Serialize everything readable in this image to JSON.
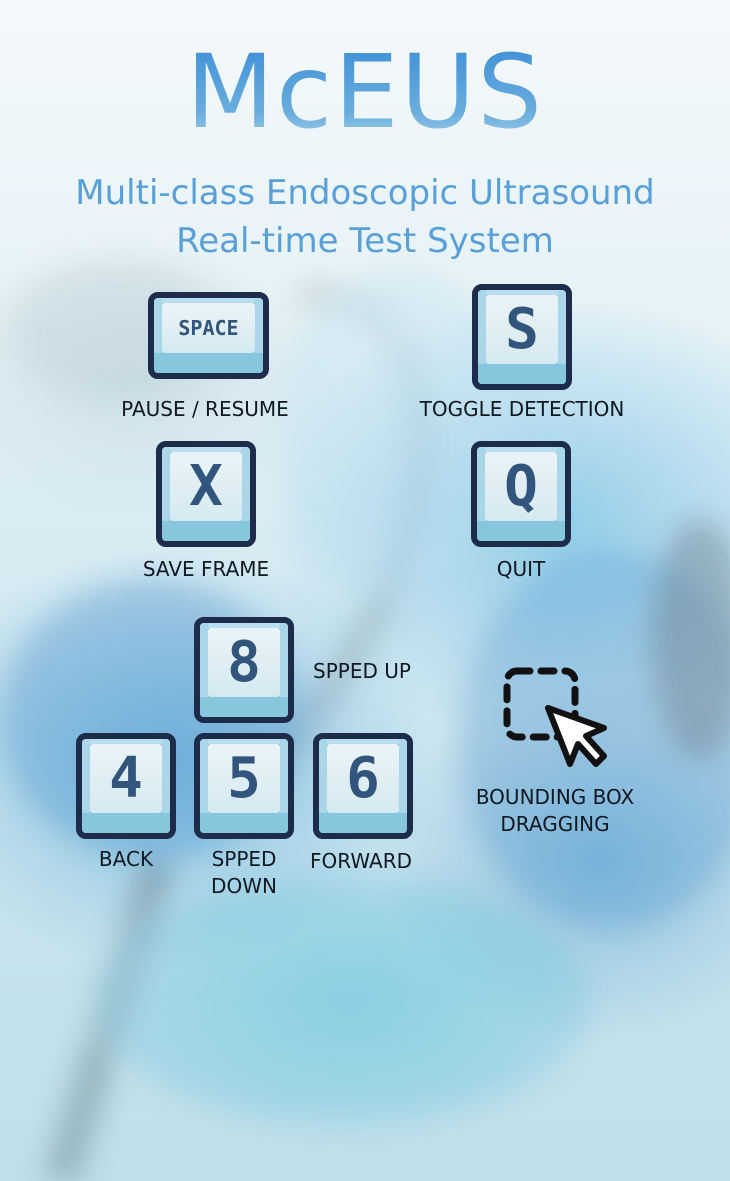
{
  "app": {
    "title": "McEUS",
    "subtitle_line1": "Multi-class Endoscopic Ultrasound",
    "subtitle_line2": "Real-time Test System"
  },
  "colors": {
    "title": "#5a9fd4",
    "subtitle": "#5aa0d8",
    "key_border": "#1c2c4a",
    "key_glyph": "#31557d",
    "key_base": "#7ec3dc",
    "label": "#101820"
  },
  "controls": [
    {
      "key": "SPACE",
      "label": "PAUSE / RESUME"
    },
    {
      "key": "S",
      "label": "TOGGLE DETECTION"
    },
    {
      "key": "X",
      "label": "SAVE FRAME"
    },
    {
      "key": "Q",
      "label": "QUIT"
    },
    {
      "key": "8",
      "label": "SPPED UP"
    },
    {
      "key": "4",
      "label": "BACK"
    },
    {
      "key": "5",
      "label_line1": "SPPED",
      "label_line2": "DOWN"
    },
    {
      "key": "6",
      "label": "FORWARD"
    }
  ],
  "mouse_action": {
    "icon": "drag-select-cursor-icon",
    "label_line1": "BOUNDING BOX",
    "label_line2": "DRAGGING"
  }
}
